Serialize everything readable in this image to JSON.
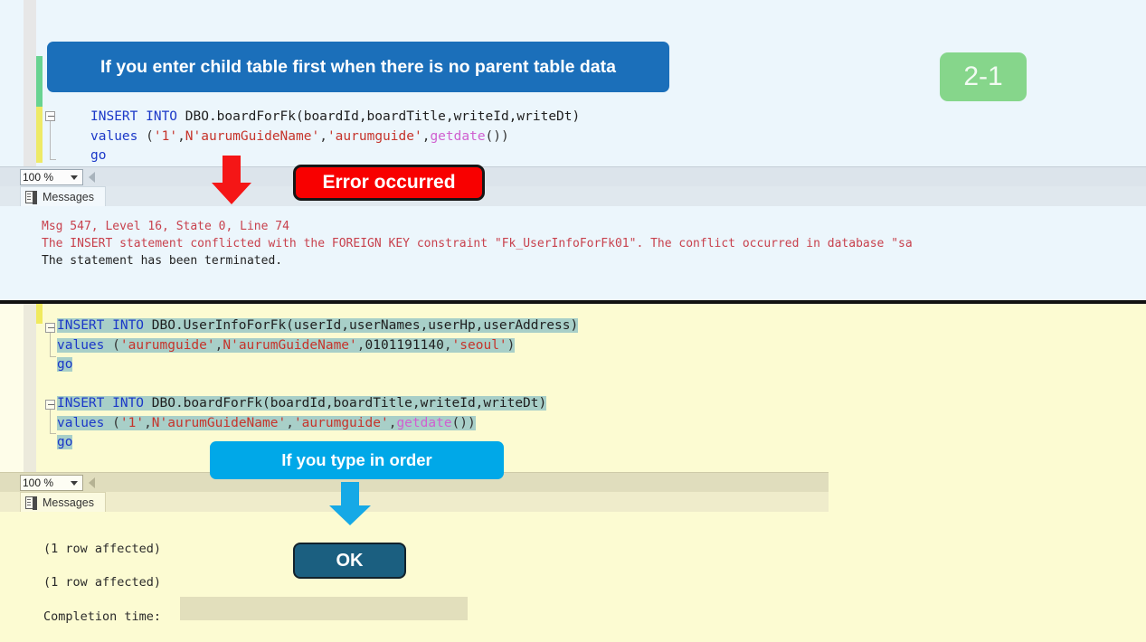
{
  "top_pane": {
    "code_lines": [
      [
        {
          "t": "INSERT INTO",
          "c": "kw"
        },
        {
          "t": " DBO",
          "c": "plain"
        },
        {
          "t": ".boardForFk(boardId,boardTitle,writeId,writeDt)",
          "c": "plain"
        }
      ],
      [
        {
          "t": "values",
          "c": "kw"
        },
        {
          "t": " (",
          "c": "pun"
        },
        {
          "t": "'1'",
          "c": "str"
        },
        {
          "t": ",",
          "c": "pun"
        },
        {
          "t": "N'aurumGuideName'",
          "c": "str"
        },
        {
          "t": ",",
          "c": "pun"
        },
        {
          "t": "'aurumguide'",
          "c": "str"
        },
        {
          "t": ",",
          "c": "pun"
        },
        {
          "t": "getdate",
          "c": "fn"
        },
        {
          "t": "())",
          "c": "pun"
        }
      ],
      [
        {
          "t": "go",
          "c": "kw"
        }
      ]
    ],
    "zoom_level": "100 %",
    "messages_tab_label": "Messages",
    "messages": [
      {
        "text": "Msg 547, Level 16, State 0, Line 74",
        "style": "error"
      },
      {
        "text": "The INSERT statement conflicted with the FOREIGN KEY constraint \"Fk_UserInfoForFk01\". The conflict occurred in database \"sa",
        "style": "error"
      },
      {
        "text": "The statement has been terminated.",
        "style": "normal"
      }
    ]
  },
  "bottom_pane": {
    "code_lines": [
      [
        {
          "t": "INSERT INTO",
          "c": "kw"
        },
        {
          "t": " DBO",
          "c": "plain"
        },
        {
          "t": ".UserInfoForFk(userId,userNames,userHp,userAddress)",
          "c": "plain"
        }
      ],
      [
        {
          "t": "values",
          "c": "kw"
        },
        {
          "t": " (",
          "c": "pun"
        },
        {
          "t": "'aurumguide'",
          "c": "str"
        },
        {
          "t": ",",
          "c": "pun"
        },
        {
          "t": "N'aurumGuideName'",
          "c": "str"
        },
        {
          "t": ",",
          "c": "pun"
        },
        {
          "t": "0101191140",
          "c": "plain"
        },
        {
          "t": ",",
          "c": "pun"
        },
        {
          "t": "'seoul'",
          "c": "str"
        },
        {
          "t": ")",
          "c": "pun"
        }
      ],
      [
        {
          "t": "go",
          "c": "kw"
        }
      ],
      [],
      [
        {
          "t": "INSERT INTO",
          "c": "kw"
        },
        {
          "t": " DBO",
          "c": "plain"
        },
        {
          "t": ".boardForFk(boardId,boardTitle,writeId,writeDt)",
          "c": "plain"
        }
      ],
      [
        {
          "t": "values",
          "c": "kw"
        },
        {
          "t": " (",
          "c": "pun"
        },
        {
          "t": "'1'",
          "c": "str"
        },
        {
          "t": ",",
          "c": "pun"
        },
        {
          "t": "N'aurumGuideName'",
          "c": "str"
        },
        {
          "t": ",",
          "c": "pun"
        },
        {
          "t": "'aurumguide'",
          "c": "str"
        },
        {
          "t": ",",
          "c": "pun"
        },
        {
          "t": "getdate",
          "c": "fn"
        },
        {
          "t": "())",
          "c": "pun"
        }
      ],
      [
        {
          "t": "go",
          "c": "kw"
        }
      ]
    ],
    "zoom_level": "100 %",
    "messages_tab_label": "Messages",
    "messages": [
      "(1 row affected)",
      "(1 row affected)",
      "Completion time:"
    ]
  },
  "annotations": {
    "top_callout": "If you enter child table first when there is no parent table data",
    "error_callout": "Error occurred",
    "order_callout": "If you type in order",
    "ok_button": "OK",
    "step_badge": "2-1"
  },
  "colors": {
    "top_callout_bg": "#1b6fba",
    "error_bg": "#f80000",
    "order_bg": "#00a8e8",
    "ok_bg": "#1b5f80",
    "badge_bg": "#86d68b",
    "selection": "#a8cfc8",
    "error_text": "#c8414d"
  }
}
